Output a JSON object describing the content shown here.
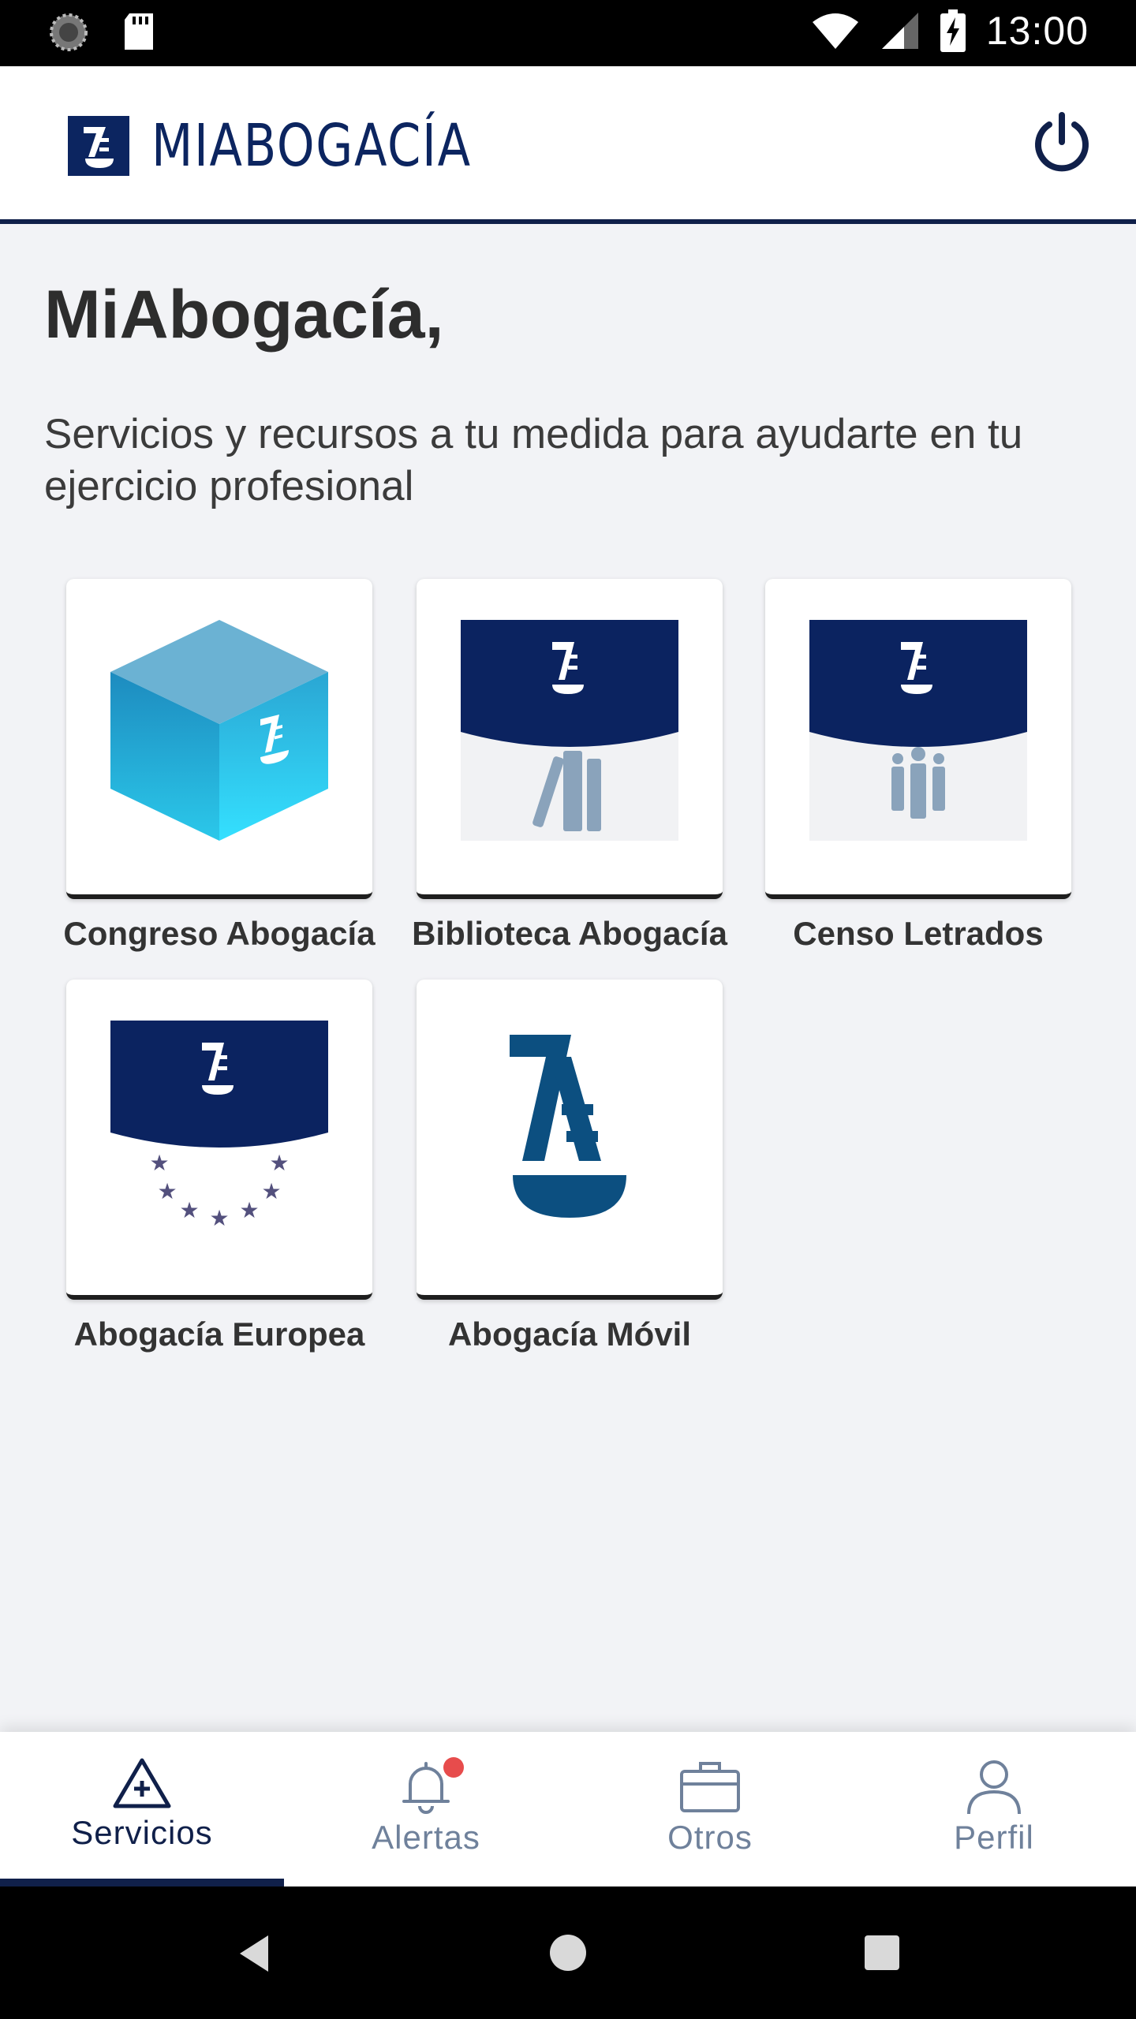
{
  "status_bar": {
    "time": "13:00",
    "icons": [
      "loading-icon",
      "sd-card-icon",
      "wifi-icon",
      "signal-icon",
      "battery-charging-icon"
    ]
  },
  "app_bar": {
    "logo_mark": "Æ",
    "logo_text": "MIABOGACÍA",
    "power_icon": "power-icon"
  },
  "main": {
    "heading": "MiAbogacía,",
    "subtitle": "Servicios y recursos a tu medida para ayudarte en tu ejercicio profesional",
    "services": [
      {
        "label": "Congreso Abogacía",
        "icon": "cube-icon"
      },
      {
        "label": "Biblioteca Abogacía",
        "icon": "books-icon"
      },
      {
        "label": "Censo Letrados",
        "icon": "people-icon"
      },
      {
        "label": "Abogacía Europea",
        "icon": "eu-stars-icon"
      },
      {
        "label": "Abogacía Móvil",
        "icon": "abogacia-logo-icon"
      }
    ]
  },
  "bottom_nav": {
    "items": [
      {
        "label": "Servicios",
        "icon": "services-icon",
        "active": true
      },
      {
        "label": "Alertas",
        "icon": "bell-icon",
        "badge": true
      },
      {
        "label": "Otros",
        "icon": "briefcase-icon"
      },
      {
        "label": "Perfil",
        "icon": "user-icon"
      }
    ]
  },
  "system_nav": {
    "icons": [
      "back-icon",
      "home-icon",
      "recents-icon"
    ]
  },
  "colors": {
    "brand_navy": "#0c2560",
    "background": "#f2f3f6",
    "nav_inactive": "#6f819b",
    "badge_red": "#e74c4c"
  }
}
